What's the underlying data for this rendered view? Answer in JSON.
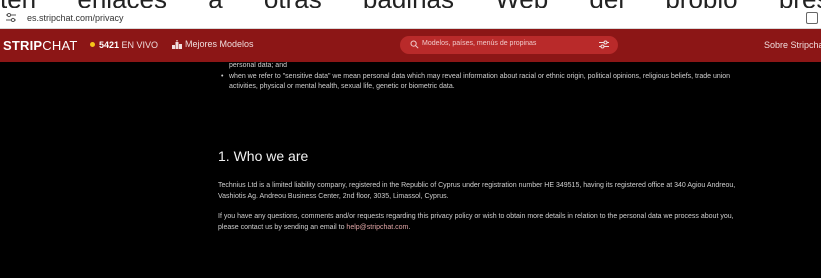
{
  "overlay": {
    "text": "ten enlaces a otras páginas Web del propio prest"
  },
  "browser": {
    "url": "es.stripchat.com/privacy",
    "site_icon": "tune-icon",
    "extension_icon": "square-icon"
  },
  "navbar": {
    "logo_part1": "STRIP",
    "logo_part2": "CHAT",
    "live_count": "5421",
    "live_label": "EN VIVO",
    "top_models_label": "Mejores Modelos",
    "search_placeholder": "Modelos, países, menús de propinas",
    "about_label": "Sobre Stripchat",
    "brand_color": "#8c1616"
  },
  "content": {
    "partial_line": "personal data; and",
    "bullet_mark": "•",
    "bullet_text": "when we refer to \"sensitive data\" we mean personal data which may reveal information about racial or ethnic origin, political opinions, religious beliefs, trade union activities, physical or mental health, sexual life, genetic or biometric data.",
    "heading": "1. Who we are",
    "para1": "Technius Ltd is a limited liability company, registered in the Republic of Cyprus under registration number HE 349515, having its registered office at 340 Agiou Andreou, Vashiotis Ag. Andreou Business Center, 2nd floor, 3035, Limassol, Cyprus.",
    "para2_text": "If you have any questions, comments and/or requests regarding this privacy policy or wish to obtain more details in relation to the personal data we process about you, please contact us by sending an email to",
    "para2_email": "help@stripchat.com",
    "para2_end": "."
  }
}
